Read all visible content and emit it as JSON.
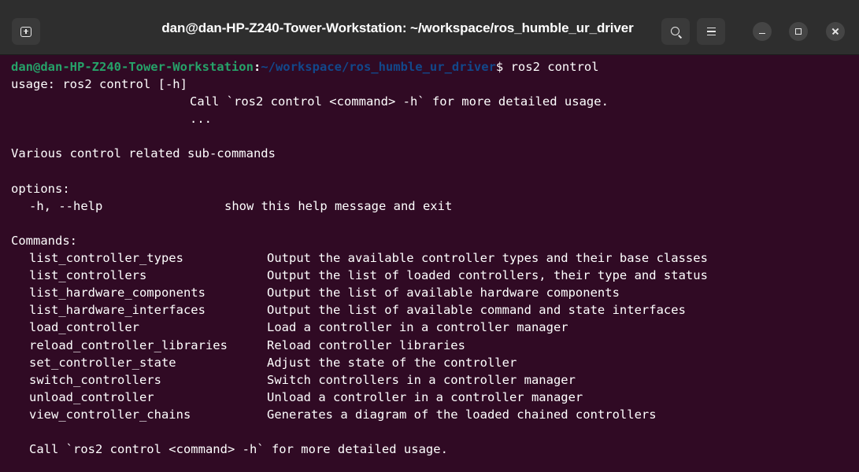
{
  "window": {
    "title": "dan@dan-HP-Z240-Tower-Workstation: ~/workspace/ros_humble_ur_driver"
  },
  "terminal": {
    "prompt": {
      "user_host": "dan@dan-HP-Z240-Tower-Workstation",
      "separator": ":",
      "path": "~/workspace/ros_humble_ur_driver",
      "symbol": "$",
      "command": " ros2 control"
    },
    "usage_line": "usage: ros2 control [-h]",
    "usage_detail": "Call `ros2 control <command> -h` for more detailed usage.",
    "usage_ellipsis": "...",
    "description": "Various control related sub-commands",
    "options_header": "options:",
    "options": [
      {
        "flag": "-h, --help",
        "description": "show this help message and exit"
      }
    ],
    "commands_header": "Commands:",
    "commands": [
      {
        "name": "list_controller_types",
        "description": "Output the available controller types and their base classes"
      },
      {
        "name": "list_controllers",
        "description": "Output the list of loaded controllers, their type and status"
      },
      {
        "name": "list_hardware_components",
        "description": "Output the list of available hardware components"
      },
      {
        "name": "list_hardware_interfaces",
        "description": "Output the list of available command and state interfaces"
      },
      {
        "name": "load_controller",
        "description": "Load a controller in a controller manager"
      },
      {
        "name": "reload_controller_libraries",
        "description": "Reload controller libraries"
      },
      {
        "name": "set_controller_state",
        "description": "Adjust the state of the controller"
      },
      {
        "name": "switch_controllers",
        "description": "Switch controllers in a controller manager"
      },
      {
        "name": "unload_controller",
        "description": "Unload a controller in a controller manager"
      },
      {
        "name": "view_controller_chains",
        "description": "Generates a diagram of the loaded chained controllers"
      }
    ],
    "footer_note": "Call `ros2 control <command> -h` for more detailed usage."
  },
  "icons": {
    "new_tab": "new-tab-icon",
    "search": "search-icon",
    "menu": "hamburger-menu-icon",
    "minimize": "minimize-icon",
    "maximize": "maximize-icon",
    "close": "close-icon"
  },
  "colors": {
    "terminal_background": "#300a24",
    "prompt_user": "#26a269",
    "prompt_path": "#12488b",
    "text": "#ffffff",
    "header_bar": "#2e2e2e"
  }
}
